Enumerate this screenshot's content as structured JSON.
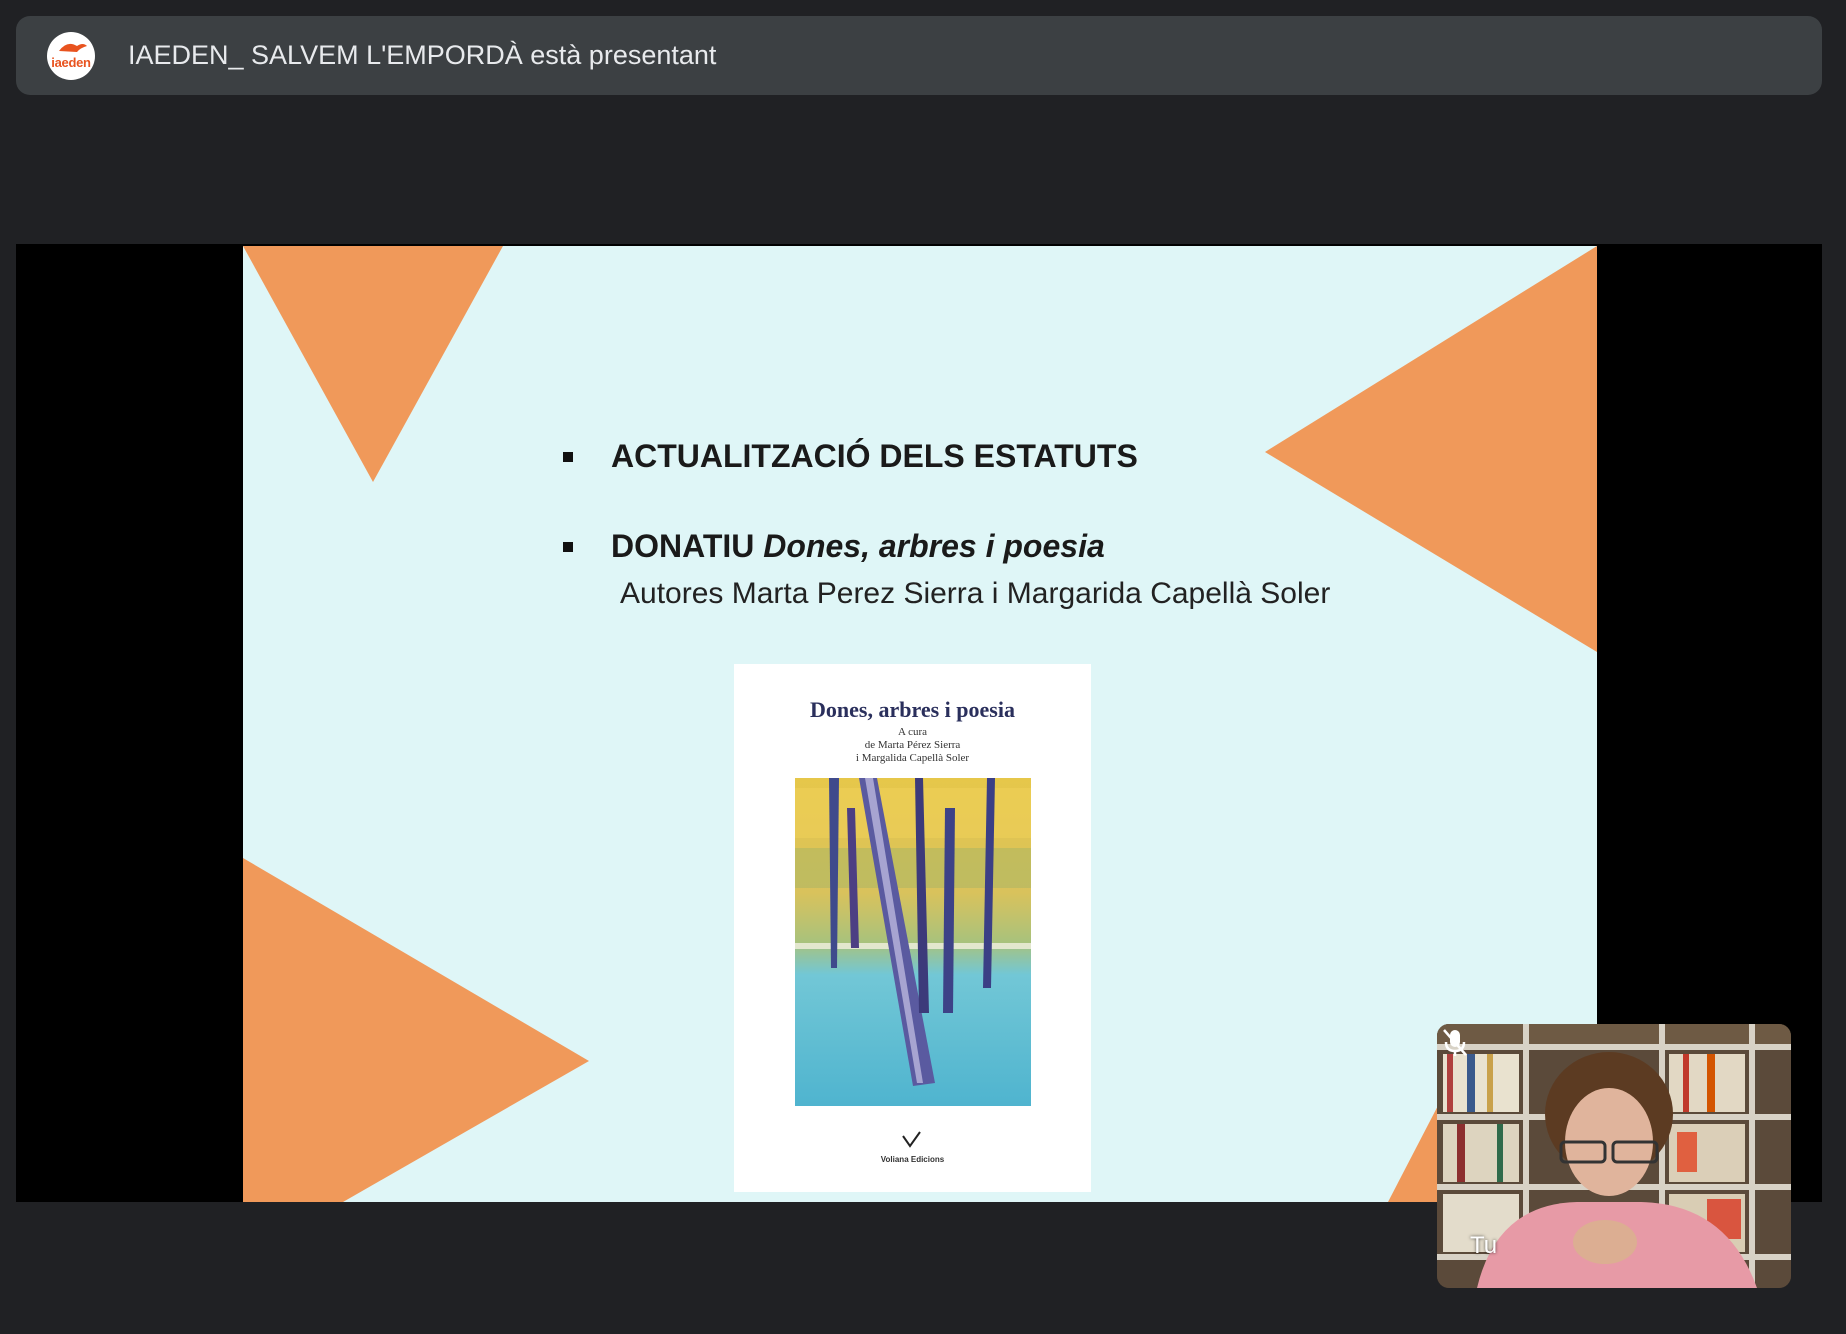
{
  "banner": {
    "logo_text": "iaeden",
    "title": "IAEDEN_ SALVEM L'EMPORDÀ està presentant"
  },
  "slide": {
    "items": [
      {
        "text": "ACTUALITZACIÓ  DELS ESTATUTS"
      },
      {
        "prefix": "DONATIU ",
        "emphasis": "Dones, arbres i poesia"
      }
    ],
    "authors_line": "Autores Marta Perez Sierra i Margarida Capellà Soler",
    "book": {
      "title": "Dones, arbres i poesia",
      "sub_1": "A cura",
      "sub_2": "de Marta Pérez Sierra",
      "sub_3": "i Margalida Capellà Soler",
      "publisher": "Voliana Edicions"
    },
    "colors": {
      "background": "#dff6f7",
      "accent": "#f0995a"
    }
  },
  "self_view": {
    "label": "Tu",
    "mic_icon": "mic-off-icon"
  }
}
